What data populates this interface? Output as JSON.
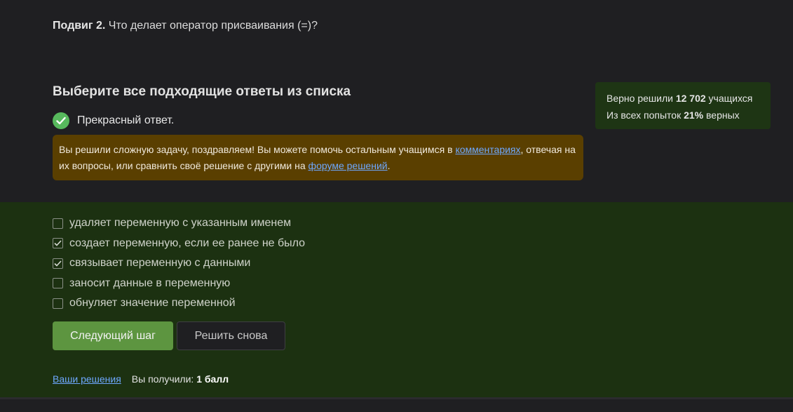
{
  "question": {
    "label": "Подвиг 2.",
    "text": " Что делает оператор присваивания (=)?"
  },
  "instruction": "Выберите все подходящие ответы из списка",
  "result": {
    "icon": "check-circle-icon",
    "text": "Прекрасный ответ."
  },
  "notice": {
    "text_before": "Вы решили сложную задачу, поздравляем! Вы можете помочь остальным учащимся в ",
    "link_comments": "комментариях",
    "text_middle": ", отвечая на их вопросы, или сравнить своё решение с другими на ",
    "link_forum": "форуме решений",
    "text_after": "."
  },
  "stats": {
    "line1_prefix": "Верно решили ",
    "solved_count": "12 702",
    "line1_suffix": " учащихся",
    "line2_prefix": "Из всех попыток ",
    "percent": "21%",
    "line2_suffix": " верных"
  },
  "options": [
    {
      "label": "удаляет переменную с указанным именем",
      "checked": false
    },
    {
      "label": "создает переменную, если ее ранее не было",
      "checked": true
    },
    {
      "label": "связывает переменную с данными",
      "checked": true
    },
    {
      "label": "заносит данные в переменную",
      "checked": false
    },
    {
      "label": "обнуляет значение переменной",
      "checked": false
    }
  ],
  "buttons": {
    "next": "Следующий шаг",
    "retry": "Решить снова"
  },
  "footer": {
    "solutions_link": "Ваши решения",
    "score_prefix": "Вы получили: ",
    "score_value": "1 балл"
  },
  "colors": {
    "success_green": "#57b95d",
    "answers_bg": "#1c3111",
    "notice_bg": "#5a3f00",
    "link": "#6ea8ff",
    "primary_button": "#5d9540"
  }
}
